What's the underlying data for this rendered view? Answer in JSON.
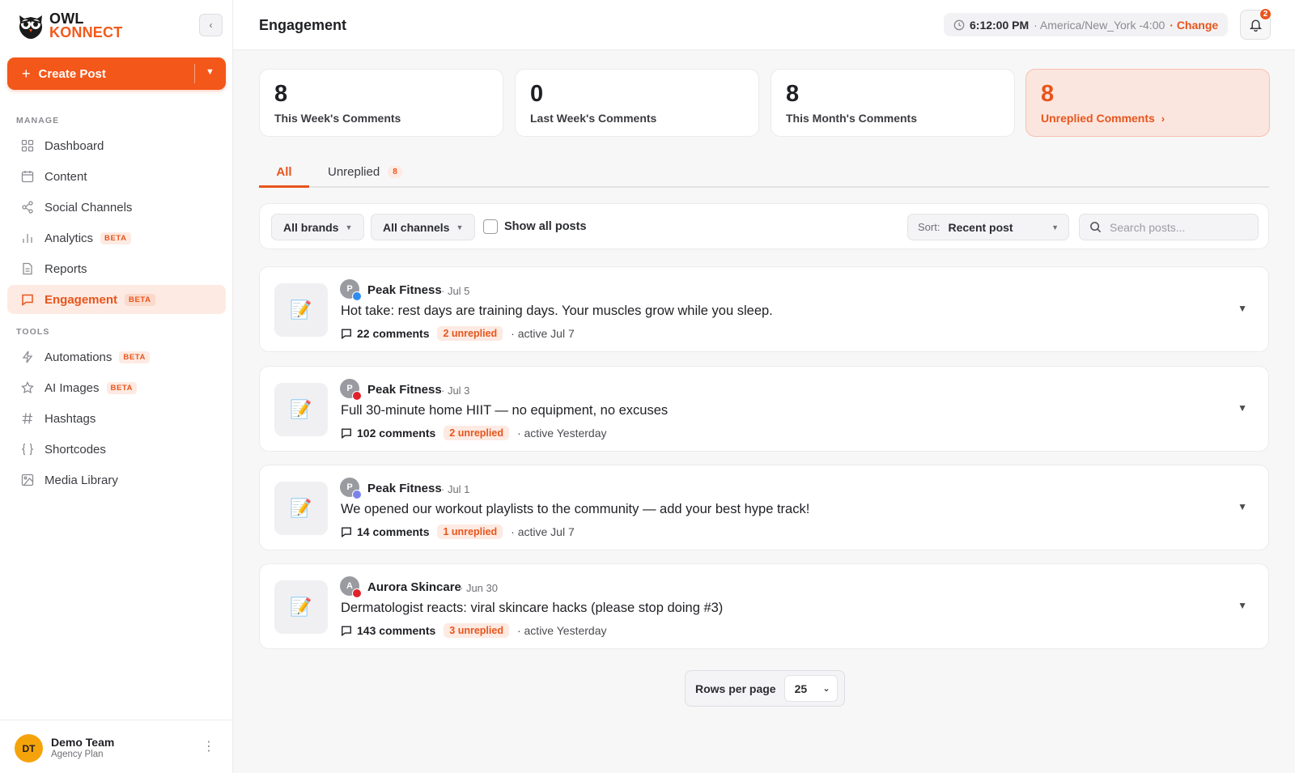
{
  "brand": {
    "line1": "OWL",
    "line2": "KONNECT"
  },
  "sidebar": {
    "create_post_label": "Create Post",
    "sections": [
      {
        "title": "MANAGE"
      },
      {
        "title": "TOOLS"
      }
    ],
    "items": [
      {
        "label": "Dashboard",
        "icon": "grid-icon",
        "beta": ""
      },
      {
        "label": "Content",
        "icon": "calendar-icon",
        "beta": ""
      },
      {
        "label": "Social Channels",
        "icon": "share-icon",
        "beta": ""
      },
      {
        "label": "Analytics",
        "icon": "bar-chart-icon",
        "beta": "BETA"
      },
      {
        "label": "Reports",
        "icon": "document-icon",
        "beta": ""
      },
      {
        "label": "Engagement",
        "icon": "comment-icon",
        "beta": "BETA",
        "active": true
      },
      {
        "label": "Automations",
        "icon": "bolt-icon",
        "beta": "BETA"
      },
      {
        "label": "AI Images",
        "icon": "star-icon",
        "beta": "BETA"
      },
      {
        "label": "Hashtags",
        "icon": "hash-icon",
        "beta": ""
      },
      {
        "label": "Shortcodes",
        "icon": "braces-icon",
        "beta": ""
      },
      {
        "label": "Media Library",
        "icon": "image-icon",
        "beta": ""
      }
    ],
    "user": {
      "initials": "DT",
      "name": "Demo Team",
      "plan": "Agency Plan"
    }
  },
  "header": {
    "title": "Engagement",
    "time": "6:12:00 PM",
    "timezone": "· America/New_York -4:00",
    "change_label": "· Change",
    "notification_count": "2"
  },
  "stats": [
    {
      "value": "8",
      "label": "This Week's Comments"
    },
    {
      "value": "0",
      "label": "Last Week's Comments"
    },
    {
      "value": "8",
      "label": "This Month's Comments"
    },
    {
      "value": "8",
      "label": "Unreplied Comments",
      "highlight": true
    }
  ],
  "tabs": [
    {
      "label": "All",
      "active": true
    },
    {
      "label": "Unreplied",
      "count": "8"
    }
  ],
  "filters": {
    "brands": "All brands",
    "channels": "All channels",
    "show_all_posts": "Show all posts",
    "sort_label": "Sort:",
    "sort_value": "Recent post",
    "search_placeholder": "Search posts..."
  },
  "posts": [
    {
      "avatar": "P",
      "brand": "Peak Fitness",
      "date": "· Jul 5",
      "title": "Hot take: rest days are training days. Your muscles grow while you sleep.",
      "comments": "22 comments",
      "unreplied": "2 unreplied",
      "active": "· active Jul 7",
      "network_color": "#2d8cf0",
      "thumb": "📝"
    },
    {
      "avatar": "P",
      "brand": "Peak Fitness",
      "date": "· Jul 3",
      "title": "Full 30-minute home HIIT — no equipment, no excuses",
      "comments": "102 comments",
      "unreplied": "2 unreplied",
      "active": "· active Yesterday",
      "network_color": "#e0222b",
      "thumb": "📝"
    },
    {
      "avatar": "P",
      "brand": "Peak Fitness",
      "date": "· Jul 1",
      "title": "We opened our workout playlists to the community — add your best hype track!",
      "comments": "14 comments",
      "unreplied": "1 unreplied",
      "active": "· active Jul 7",
      "network_color": "#7b83eb",
      "thumb": "📝"
    },
    {
      "avatar": "A",
      "brand": "Aurora Skincare",
      "date": "· Jun 30",
      "title": "Dermatologist reacts: viral skincare hacks (please stop doing #3)",
      "comments": "143 comments",
      "unreplied": "3 unreplied",
      "active": "· active Yesterday",
      "network_color": "#e0222b",
      "thumb": "📝"
    }
  ],
  "pagination": {
    "label": "Rows per page",
    "value": "25"
  }
}
